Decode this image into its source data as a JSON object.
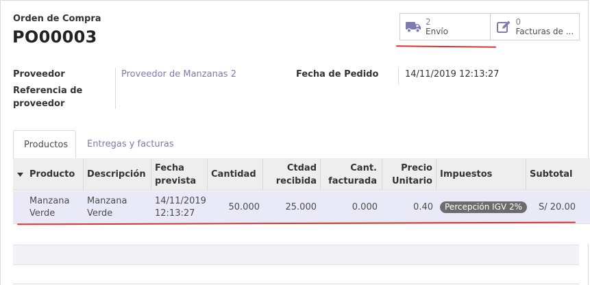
{
  "form": {
    "caption": "Orden de Compra",
    "name": "PO00003"
  },
  "smart_buttons": [
    {
      "icon": "truck-icon",
      "count": "2",
      "label": "Envío"
    },
    {
      "icon": "edit-icon",
      "count": "0",
      "label": "Facturas de ..."
    }
  ],
  "fields": {
    "vendor_label": "Proveedor",
    "vendor_value": "Proveedor de Manzanas 2",
    "vendor_ref_label_1": "Referencia de",
    "vendor_ref_label_2": "proveedor",
    "order_date_label": "Fecha de Pedido",
    "order_date_value": "14/11/2019 12:13:27"
  },
  "tabs": [
    {
      "label": "Productos",
      "active": true
    },
    {
      "label": "Entregas y facturas",
      "active": false
    }
  ],
  "table": {
    "sort_icon": "caret-down-icon",
    "headers": {
      "product": "Producto",
      "description": "Descripción",
      "date_1": "Fecha",
      "date_2": "prevista",
      "qty": "Cantidad",
      "received_1": "Ctdad",
      "received_2": "recibida",
      "billed_1": "Cant.",
      "billed_2": "facturada",
      "price_1": "Precio",
      "price_2": "Unitario",
      "taxes": "Impuestos",
      "subtotal": "Subtotal"
    },
    "rows": [
      {
        "product_1": "Manzana",
        "product_2": "Verde",
        "description_1": "Manzana",
        "description_2": "Verde",
        "date_1": "14/11/2019",
        "date_2": "12:13:27",
        "qty": "50.000",
        "received": "25.000",
        "billed": "0.000",
        "price": "0.40",
        "tax": "Percepción IGV 2%",
        "subtotal": "S/ 20.00"
      }
    ]
  },
  "colors": {
    "link": "#7c7bad",
    "annotation_red": "#d0342c",
    "selected_row": "#e9e9f7",
    "badge": "#6c6c6c"
  }
}
